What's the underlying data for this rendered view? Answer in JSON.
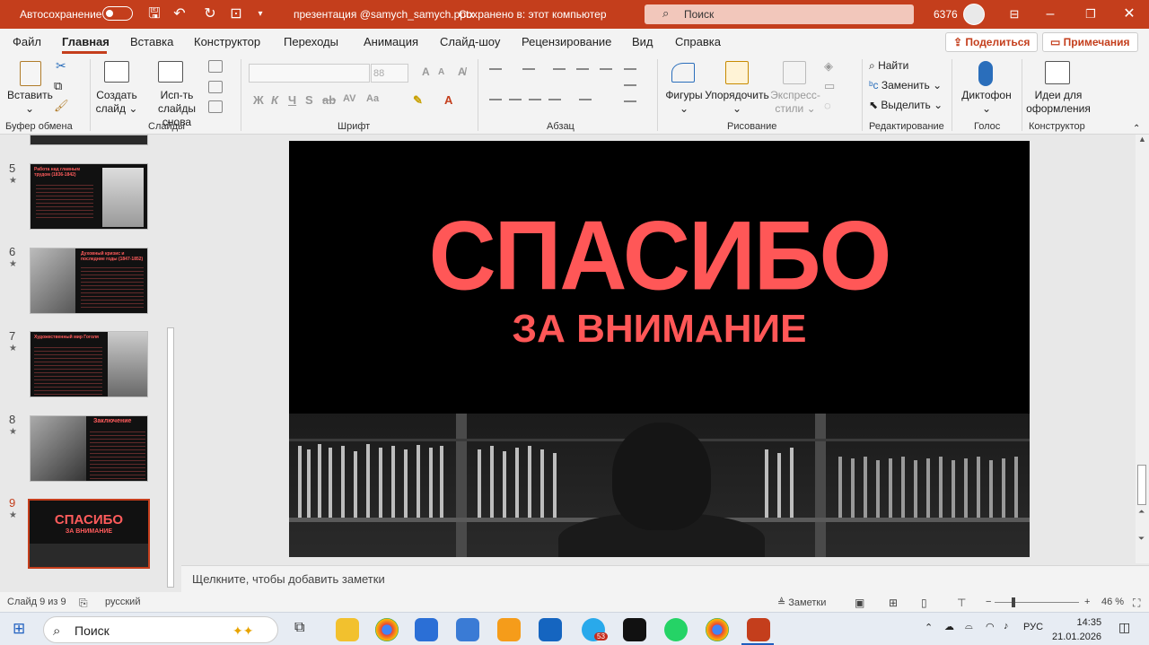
{
  "titlebar": {
    "autosave": "Автосохранение",
    "filename": "презентация @samych_samych.pptx",
    "saved": "Сохранено в: этот компьютер",
    "search_placeholder": "Поиск",
    "user_id": "6376"
  },
  "menu": {
    "tabs": [
      "Файл",
      "Главная",
      "Вставка",
      "Конструктор",
      "Переходы",
      "Анимация",
      "Слайд-шоу",
      "Рецензирование",
      "Вид",
      "Справка"
    ],
    "share": "Поделиться",
    "comments": "Примечания"
  },
  "ribbon": {
    "paste": "Вставить",
    "new_slide_1": "Создать",
    "new_slide_2": "слайд",
    "reuse_1": "Исп-ть",
    "reuse_2": "слайды снова",
    "shapes": "Фигуры",
    "arrange": "Упорядочить",
    "quick_styles_1": "Экспресс-",
    "quick_styles_2": "стили",
    "find": "Найти",
    "replace": "Заменить",
    "select": "Выделить",
    "dictate": "Диктофон",
    "designer_1": "Идеи для",
    "designer_2": "оформления",
    "font_size": "88",
    "groups": {
      "clipboard": "Буфер обмена",
      "slides": "Слайды",
      "font": "Шрифт",
      "paragraph": "Абзац",
      "drawing": "Рисование",
      "editing": "Редактирование",
      "voice": "Голос",
      "designer": "Конструктор"
    }
  },
  "thumbnails": [
    {
      "num": "5",
      "title": "Работа над главным трудом (1836-1842)"
    },
    {
      "num": "6",
      "title": "Духовный кризис и последние годы (1847-1852)"
    },
    {
      "num": "7",
      "title": "Художественный мир Гоголя"
    },
    {
      "num": "8",
      "title": "Заключение"
    },
    {
      "num": "9",
      "title": "СПАСИБО",
      "sub": "ЗА ВНИМАНИЕ"
    }
  ],
  "slide": {
    "title": "СПАСИБО",
    "subtitle": "ЗА ВНИМАНИЕ",
    "accent": "#ff5757"
  },
  "notes_placeholder": "Щелкните, чтобы добавить заметки",
  "status": {
    "slide": "Слайд 9 из 9",
    "language": "русский",
    "notes": "Заметки",
    "zoom": "46 %"
  },
  "taskbar": {
    "search": "Поиск",
    "time": "14:35",
    "date": "21.01.2026",
    "lang": "РУС",
    "badge": "53"
  }
}
